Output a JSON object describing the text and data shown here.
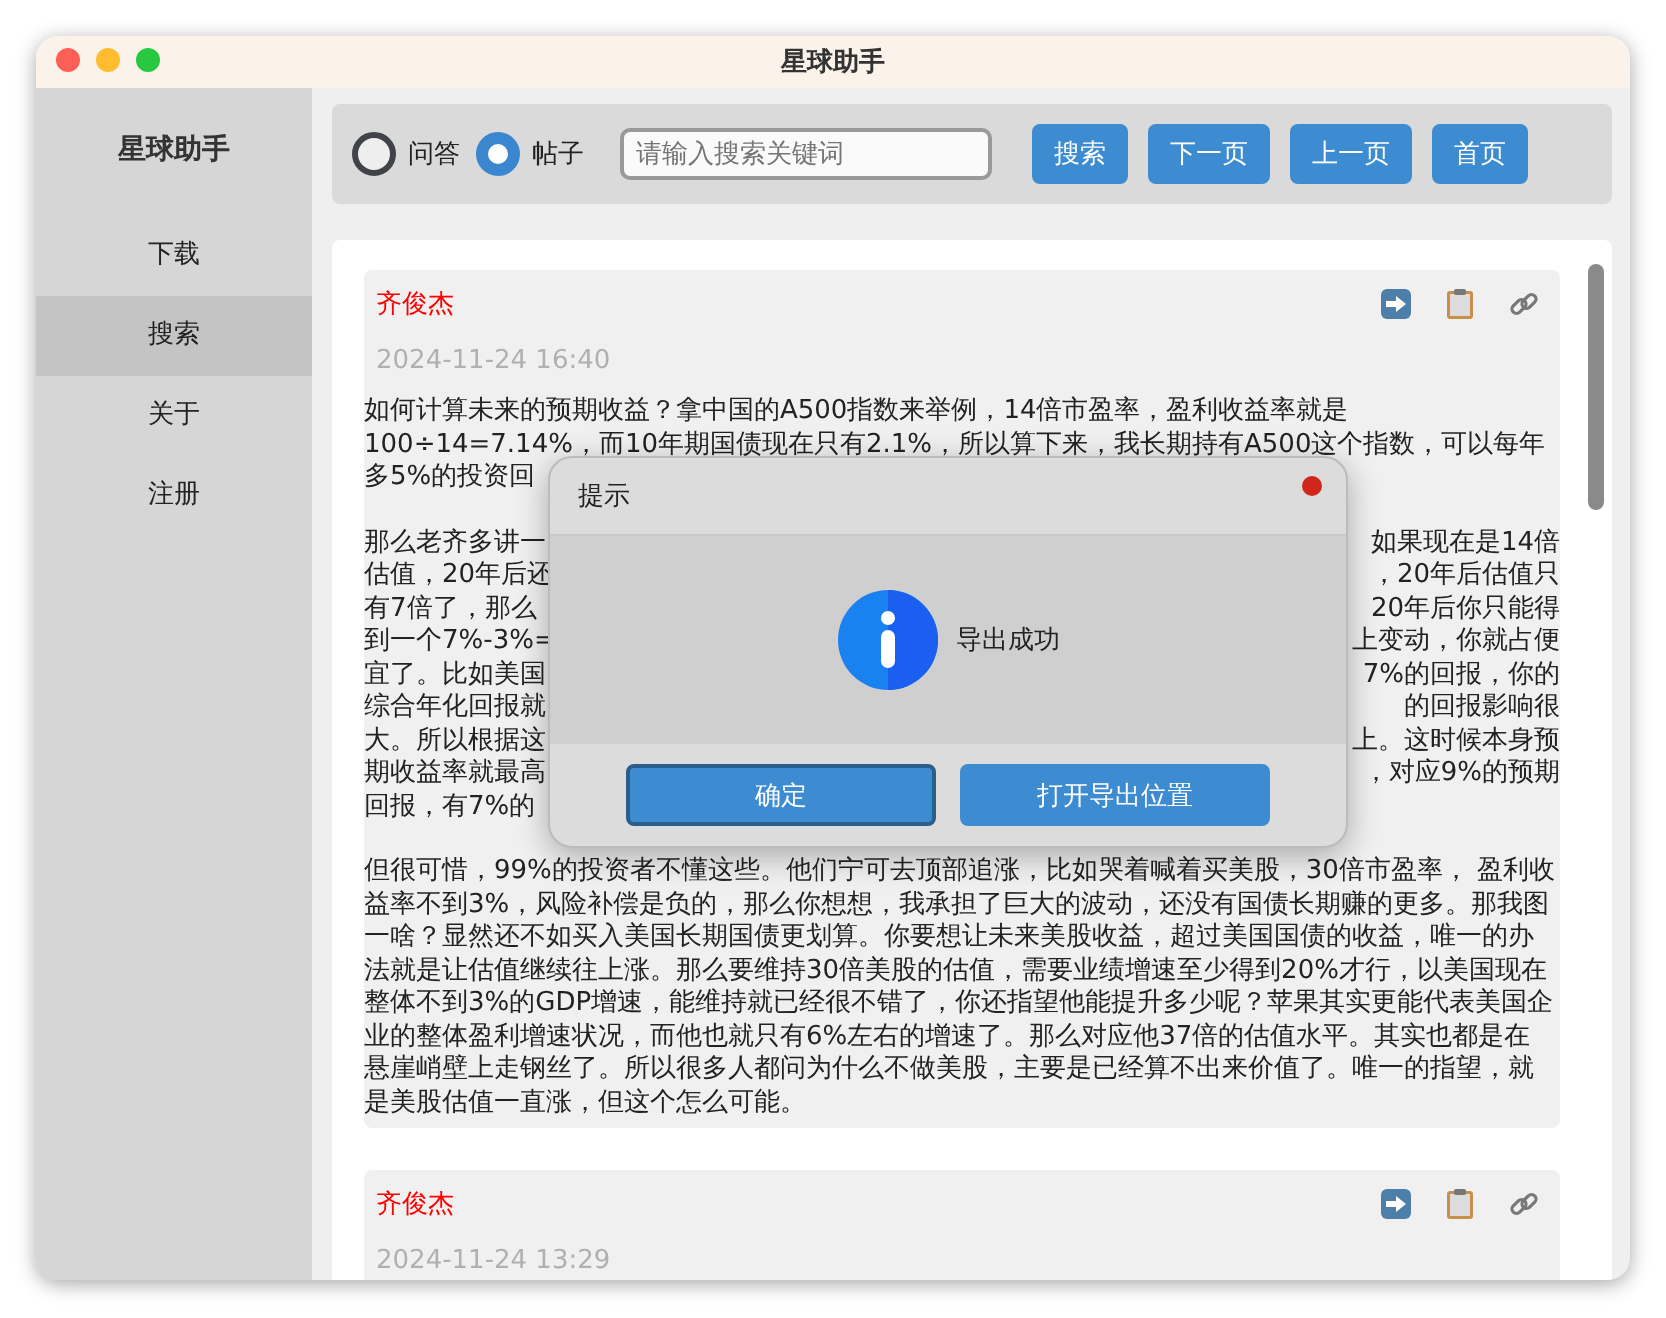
{
  "window": {
    "title": "星球助手"
  },
  "sidebar": {
    "title": "星球助手",
    "items": [
      {
        "label": "下载",
        "selected": false
      },
      {
        "label": "搜索",
        "selected": true
      },
      {
        "label": "关于",
        "selected": false
      },
      {
        "label": "注册",
        "selected": false
      }
    ]
  },
  "search_bar": {
    "modes": [
      {
        "label": "问答",
        "selected": false
      },
      {
        "label": "帖子",
        "selected": true
      }
    ],
    "placeholder": "请输入搜索关键词",
    "buttons": [
      "搜索",
      "下一页",
      "上一页",
      "首页"
    ]
  },
  "posts": [
    {
      "author": "齐俊杰",
      "time": "2024-11-24 16:40",
      "paragraphs": [
        {
          "kind": "fragments",
          "lines": [
            {
              "left": "如何计算未来的预期收益？拿中国的A500指数来举例，14倍市盈率，盈利收益率就是"
            },
            {
              "left": "100÷14=7.14%，而10年期国债现在只有2.1%，所以算下来，我长期持有A500这个指数，可以每年"
            },
            {
              "left": "多5%的投资回"
            }
          ]
        },
        {
          "kind": "fragments",
          "lines": [
            {
              "left": "那么老齐多讲一",
              "right": "如果现在是14倍"
            },
            {
              "left": "估值，20年后还",
              "right": "，20年后估值只"
            },
            {
              "left": "有7倍了，那么",
              "right": "20年后你只能得"
            },
            {
              "left": "到一个7%-3%=",
              "right": "上变动，你就占便"
            },
            {
              "left": "宜了。比如美国",
              "right": "7%的回报，你的"
            },
            {
              "left": "综合年化回报就",
              "right": "的回报影响很"
            },
            {
              "left": "大。所以根据这",
              "right": "上。这时候本身预"
            },
            {
              "left": "期收益率就最高",
              "right": "，对应9%的预期"
            },
            {
              "left": "回报，有7%的"
            }
          ]
        },
        {
          "kind": "text",
          "text": "但很可惜，99%的投资者不懂这些。他们宁可去顶部追涨，比如哭着喊着买美股，30倍市盈率， 盈利收益率不到3%，风险补偿是负的，那么你想想，我承担了巨大的波动，还没有国债长期赚的更多。那我图一啥？显然还不如买入美国长期国债更划算。你要想让未来美股收益，超过美国国债的收益，唯一的办法就是让估值继续往上涨。那么要维持30倍美股的估值，需要业绩增速至少得到20%才行，以美国现在整体不到3%的GDP增速，能维持就已经很不错了，你还指望他能提升多少呢？苹果其实更能代表美国企业的整体盈利增速状况，而他也就只有6%左右的增速了。那么对应他37倍的估值水平。其实也都是在悬崖峭壁上走钢丝了。所以很多人都问为什么不做美股，主要是已经算不出来价值了。唯一的指望，就是美股估值一直涨，但这个怎么可能。"
        }
      ]
    },
    {
      "author": "齐俊杰",
      "time": "2024-11-24 13:29"
    }
  ],
  "dialog": {
    "title": "提示",
    "message": "导出成功",
    "buttons": [
      {
        "label": "确定",
        "selected": true
      },
      {
        "label": "打开导出位置",
        "selected": false
      }
    ]
  }
}
